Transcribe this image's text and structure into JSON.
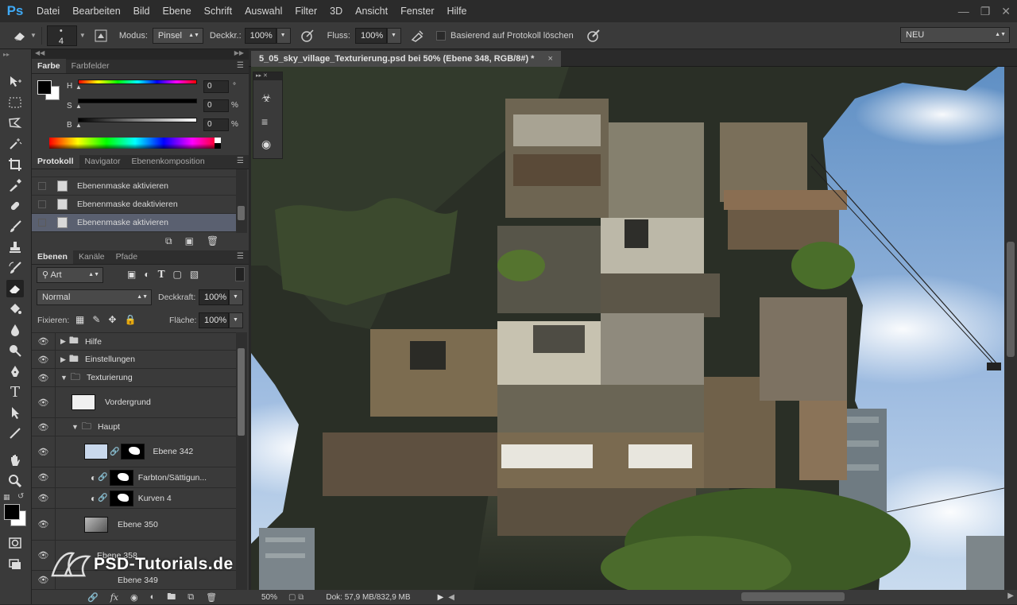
{
  "app": {
    "logo": "Ps",
    "logo_color": "#3fa9f5"
  },
  "menu": [
    "Datei",
    "Bearbeiten",
    "Bild",
    "Ebene",
    "Schrift",
    "Auswahl",
    "Filter",
    "3D",
    "Ansicht",
    "Fenster",
    "Hilfe"
  ],
  "options": {
    "brush_size": "4",
    "modus_label": "Modus:",
    "modus_value": "Pinsel",
    "deckkraft_label": "Deckkr.:",
    "deckkraft_value": "100%",
    "fluss_label": "Fluss:",
    "fluss_value": "100%",
    "protokoll_label": "Basierend auf Protokoll löschen",
    "workspace": "NEU"
  },
  "color_panel": {
    "tabs": [
      "Farbe",
      "Farbfelder"
    ],
    "h_label": "H",
    "h_value": "0",
    "h_unit": "°",
    "s_label": "S",
    "s_value": "0",
    "s_unit": "%",
    "b_label": "B",
    "b_value": "0",
    "b_unit": "%"
  },
  "history_panel": {
    "tabs": [
      "Protokoll",
      "Navigator",
      "Ebenenkomposition"
    ],
    "items": [
      "Ebenenmaske aktivieren",
      "Ebenenmaske deaktivieren",
      "Ebenenmaske aktivieren"
    ]
  },
  "layers_panel": {
    "tabs": [
      "Ebenen",
      "Kanäle",
      "Pfade"
    ],
    "filter": "Art",
    "blend_mode": "Normal",
    "opacity_label": "Deckkraft:",
    "opacity_value": "100%",
    "lock_label": "Fixieren:",
    "fill_label": "Fläche:",
    "fill_value": "100%",
    "layers": [
      {
        "name": "Hilfe",
        "type": "group"
      },
      {
        "name": "Einstellungen",
        "type": "group"
      },
      {
        "name": "Texturierung",
        "type": "group-open"
      },
      {
        "name": "Vordergrund",
        "type": "layer"
      },
      {
        "name": "Haupt",
        "type": "group-open"
      },
      {
        "name": "Ebene 342",
        "type": "layer-mask"
      },
      {
        "name": "Farbton/Sättigun...",
        "type": "adjust"
      },
      {
        "name": "Kurven 4",
        "type": "adjust"
      },
      {
        "name": "Ebene 350",
        "type": "layer"
      },
      {
        "name": "Ebene 358",
        "type": "layer"
      },
      {
        "name": "Ebene 349",
        "type": "layer"
      }
    ]
  },
  "document": {
    "tab_title": "5_05_sky_village_Texturierung.psd bei 50% (Ebene 348, RGB/8#) *",
    "close": "×"
  },
  "status": {
    "zoom": "50%",
    "doc_info": "Dok: 57,9 MB/832,9 MB"
  },
  "watermark": "PSD-Tutorials.de"
}
